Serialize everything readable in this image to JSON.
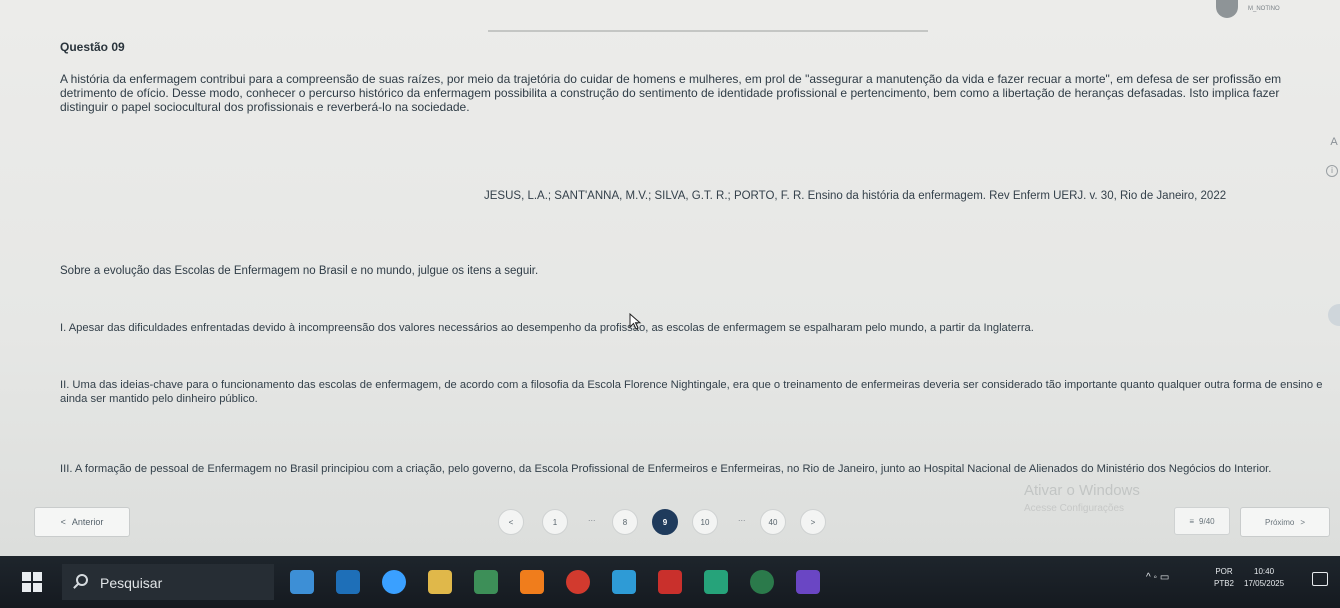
{
  "header": {
    "user_name": "M_NOTINO"
  },
  "question": {
    "title": "Questão 09",
    "intro": "A história da enfermagem contribui para a compreensão de suas raízes, por meio da trajetória do cuidar de homens e mulheres, em prol de \"assegurar a manutenção da vida e fazer recuar a morte\", em defesa de ser profissão em detrimento de ofício. Desse modo, conhecer o percurso histórico da enfermagem possibilita a construção do sentimento de identidade profissional e pertencimento, bem como a libertação de heranças defasadas. Isto implica fazer distinguir o papel sociocultural dos profissionais e reverberá-lo na sociedade.",
    "citation": "JESUS, L.A.; SANT'ANNA, M.V.; SILVA, G.T. R.; PORTO, F. R. Ensino da história da enfermagem. Rev Enferm UERJ. v. 30, Rio de Janeiro, 2022",
    "prompt": "Sobre a evolução das Escolas de Enfermagem no Brasil e no mundo, julgue os itens a seguir.",
    "items": [
      "I. Apesar das dificuldades enfrentadas devido à incompreensão dos valores necessários ao desempenho da profissão, as escolas de enfermagem se espalharam pelo mundo, a partir da Inglaterra.",
      "II. Uma das ideias-chave para o funcionamento das escolas de enfermagem, de acordo com a filosofia da Escola Florence Nightingale, era que o treinamento de enfermeiras deveria ser considerado tão importante quanto qualquer outra forma de ensino e ainda ser mantido pelo dinheiro público.",
      "III. A formação de pessoal de Enfermagem no Brasil principiou com a criação, pelo governo, da Escola Profissional de Enfermeiros e Enfermeiras, no Rio de Janeiro, junto ao Hospital Nacional de Alienados do Ministério dos Negócios do Interior."
    ]
  },
  "side": {
    "font_label": "A",
    "info_label": "i"
  },
  "watermark": {
    "line1": "Ativar o Windows",
    "line2": "Acesse Configurações"
  },
  "nav": {
    "prev_label": "Anterior",
    "prev_arrow": "<",
    "next_label": "Próximo",
    "next_arrow": ">",
    "pages": [
      "1",
      "8",
      "9",
      "10",
      "40"
    ],
    "active_page": "9",
    "pager_prev": "<",
    "pager_next": ">",
    "ellipsis": "...",
    "counter": "9/40",
    "counter_icon": "≡"
  },
  "taskbar": {
    "search_placeholder": "Pesquisar",
    "lang_top": "POR",
    "lang_bottom": "PTB2",
    "time": "10:40",
    "date": "17/05/2025",
    "tray_arrow": "^",
    "accent_colors": [
      "#3d8fd6",
      "#1e6fb8",
      "#3aa0ff",
      "#e0b84a",
      "#3d8f58",
      "#f07d1c",
      "#d23a2e",
      "#2e9bd6",
      "#c9302c",
      "#26a37a",
      "#2b7a4b",
      "#6a46c4"
    ]
  }
}
